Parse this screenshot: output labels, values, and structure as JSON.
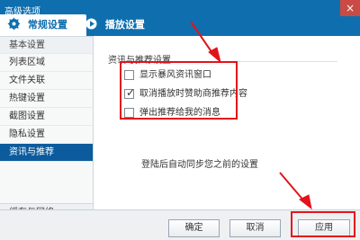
{
  "window": {
    "title": "高级选项",
    "close_label": "×"
  },
  "tabs": [
    {
      "label": "常规设置",
      "icon": "gear-icon"
    },
    {
      "label": "播放设置",
      "icon": "play-settings-icon"
    }
  ],
  "sidebar": {
    "items": [
      {
        "label": "基本设置"
      },
      {
        "label": "列表区域"
      },
      {
        "label": "文件关联"
      },
      {
        "label": "热键设置"
      },
      {
        "label": "截图设置"
      },
      {
        "label": "隐私设置"
      },
      {
        "label": "资讯与推荐"
      }
    ],
    "bottom_label": "缓存与网络"
  },
  "content": {
    "section_title": "资讯与推荐设置",
    "options": [
      {
        "label": "显示暴风资讯窗口",
        "checked": false
      },
      {
        "label": "取消播放时赞助商推荐内容",
        "checked": true
      },
      {
        "label": "弹出推荐给我的消息",
        "checked": false
      }
    ],
    "note": "登陆后自动同步您之前的设置"
  },
  "buttons": {
    "ok": "确定",
    "cancel": "取消",
    "apply": "应用"
  },
  "annotations": {
    "highlight_color": "#e3131b"
  }
}
